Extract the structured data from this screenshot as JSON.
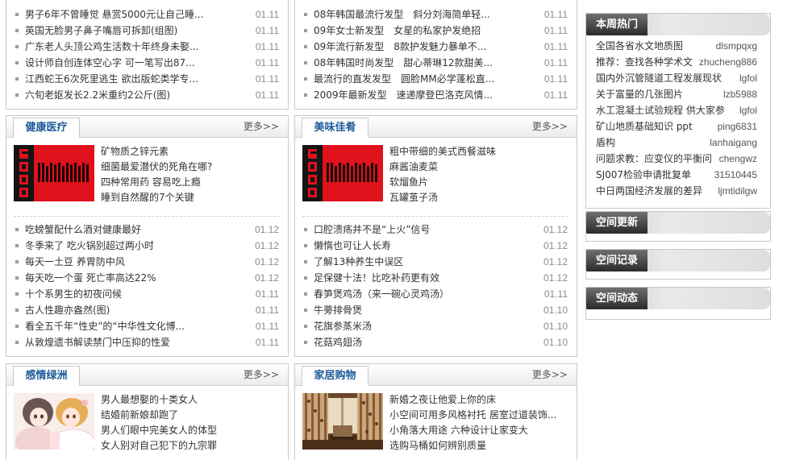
{
  "top_left": {
    "items": [
      {
        "title": "男子6年不曾睡觉 悬赏5000元让自己睡...",
        "date": "01.11"
      },
      {
        "title": "英国无脸男子鼻子嘴唇可拆卸(组图)",
        "date": "01.11"
      },
      {
        "title": "广东老人头顶公鸡生活数十年终身未娶...",
        "date": "01.11"
      },
      {
        "title": "设计师自创连体空心字 可一笔写出87...",
        "date": "01.11"
      },
      {
        "title": "江西蛇王6次死里逃生 欲出版蛇类学专...",
        "date": "01.11"
      },
      {
        "title": "六旬老妪发长2.2米重约2公斤(图)",
        "date": "01.11"
      }
    ]
  },
  "top_middle": {
    "items": [
      {
        "title": "08年韩国最流行发型　斜分刘海简单轻...",
        "date": "01.11"
      },
      {
        "title": "09年女士新发型　女星的私家护发绝招",
        "date": "01.11"
      },
      {
        "title": "09年流行新发型　8款护发魅力暴单不...",
        "date": "01.11"
      },
      {
        "title": "08年韩国时尚发型　甜心蒂琳12款甜美...",
        "date": "01.11"
      },
      {
        "title": "最流行的直发发型　圆脸MM必学蓬松直...",
        "date": "01.11"
      },
      {
        "title": "2009年最新发型　速递摩登巴洛克风情...",
        "date": "01.11"
      }
    ]
  },
  "sections": {
    "health": {
      "title": "健康医疗",
      "more": "更多>>",
      "features": [
        "矿物质之锌元素",
        "细菌最爱潜伏的死角在哪?",
        "四种常用药 容易吃上瘾",
        "睡到自然醒的7个关键"
      ],
      "items": [
        {
          "title": "吃螃蟹配什么酒对健康最好",
          "date": "01.12"
        },
        {
          "title": "冬季来了 吃火锅别超过两小时",
          "date": "01.12"
        },
        {
          "title": "每天一土豆 养胃防中风",
          "date": "01.12"
        },
        {
          "title": "每天吃一个蛋 死亡率高达22%",
          "date": "01.12"
        },
        {
          "title": "十个系男生的初夜问候",
          "date": "01.11"
        },
        {
          "title": "古人性趣亦盎然(图)",
          "date": "01.11"
        },
        {
          "title": "看全五千年“性史”的“中华性文化博...",
          "date": "01.11"
        },
        {
          "title": "从敦煌遗书解读禁门中压抑的性爱",
          "date": "01.11"
        }
      ]
    },
    "food": {
      "title": "美味佳肴",
      "more": "更多>>",
      "features": [
        "粗中带细的美式西餐滋味",
        "麻酱油麦菜",
        "软熘鱼片",
        "瓦罐茧子汤"
      ],
      "items": [
        {
          "title": "口腔溃疡并不是“上火”信号",
          "date": "01.12"
        },
        {
          "title": "懒惰也可让人长寿",
          "date": "01.12"
        },
        {
          "title": "了解13种养生中误区",
          "date": "01.12"
        },
        {
          "title": "足保健十法！比吃补药更有效",
          "date": "01.12"
        },
        {
          "title": "春笋煲鸡汤（来一碗心灵鸡汤）",
          "date": "01.11"
        },
        {
          "title": "牛蒡排骨煲",
          "date": "01.10"
        },
        {
          "title": "花旗参蒸米汤",
          "date": "01.10"
        },
        {
          "title": "花菇鸡翅汤",
          "date": "01.10"
        }
      ]
    },
    "emotion": {
      "title": "感情绿洲",
      "more": "更多>>",
      "features": [
        "男人最想娶的十类女人",
        "结婚前新娘却跑了",
        "男人们眼中完美女人的体型",
        "女人别对自己犯下的九宗罪"
      ]
    },
    "home": {
      "title": "家居购物",
      "more": "更多>>",
      "features": [
        "新婚之夜让他爱上你的床",
        "小空间可用多风格衬托 居室过道装饰...",
        "小角落大用途 六种设计让家变大",
        "选购马桶如何辨别质量"
      ]
    }
  },
  "sidebar": {
    "hot": {
      "title": "本周热门",
      "items": [
        {
          "title": "全国各省水文地质图",
          "user": "dlsmpqxg"
        },
        {
          "title": "推荐：查找各种学术文",
          "user": "zhucheng886"
        },
        {
          "title": "国内外沉管隧道工程发展现状",
          "user": "lgfol"
        },
        {
          "title": "关于富量的几张图片",
          "user": "lzb5988"
        },
        {
          "title": "水工混凝土试验规程 供大家参",
          "user": "lgfol"
        },
        {
          "title": "矿山地质基础知识 ppt",
          "user": "ping6831"
        },
        {
          "title": "盾构",
          "user": "lanhaigang"
        },
        {
          "title": "问题求教：应变仪的平衡问",
          "user": "chengwz"
        },
        {
          "title": "SJ007检验申请批复单",
          "user": "31510445"
        },
        {
          "title": "中日两国经济发展的差异",
          "user": "ljmtidilgw"
        }
      ]
    },
    "panels": [
      {
        "title": "空间更新"
      },
      {
        "title": "空间记录"
      },
      {
        "title": "空间动态"
      }
    ]
  },
  "icons": {
    "list_bullet": "bullet-icon",
    "more_link": "chevron-right-icon"
  },
  "colors": {
    "section_title": "#1f5b99",
    "border": "#c9c9c9",
    "text": "#333333",
    "date": "#8a8a8a",
    "sidebar_tab": "#2a2a2a",
    "logo_red": "#e0121c"
  }
}
